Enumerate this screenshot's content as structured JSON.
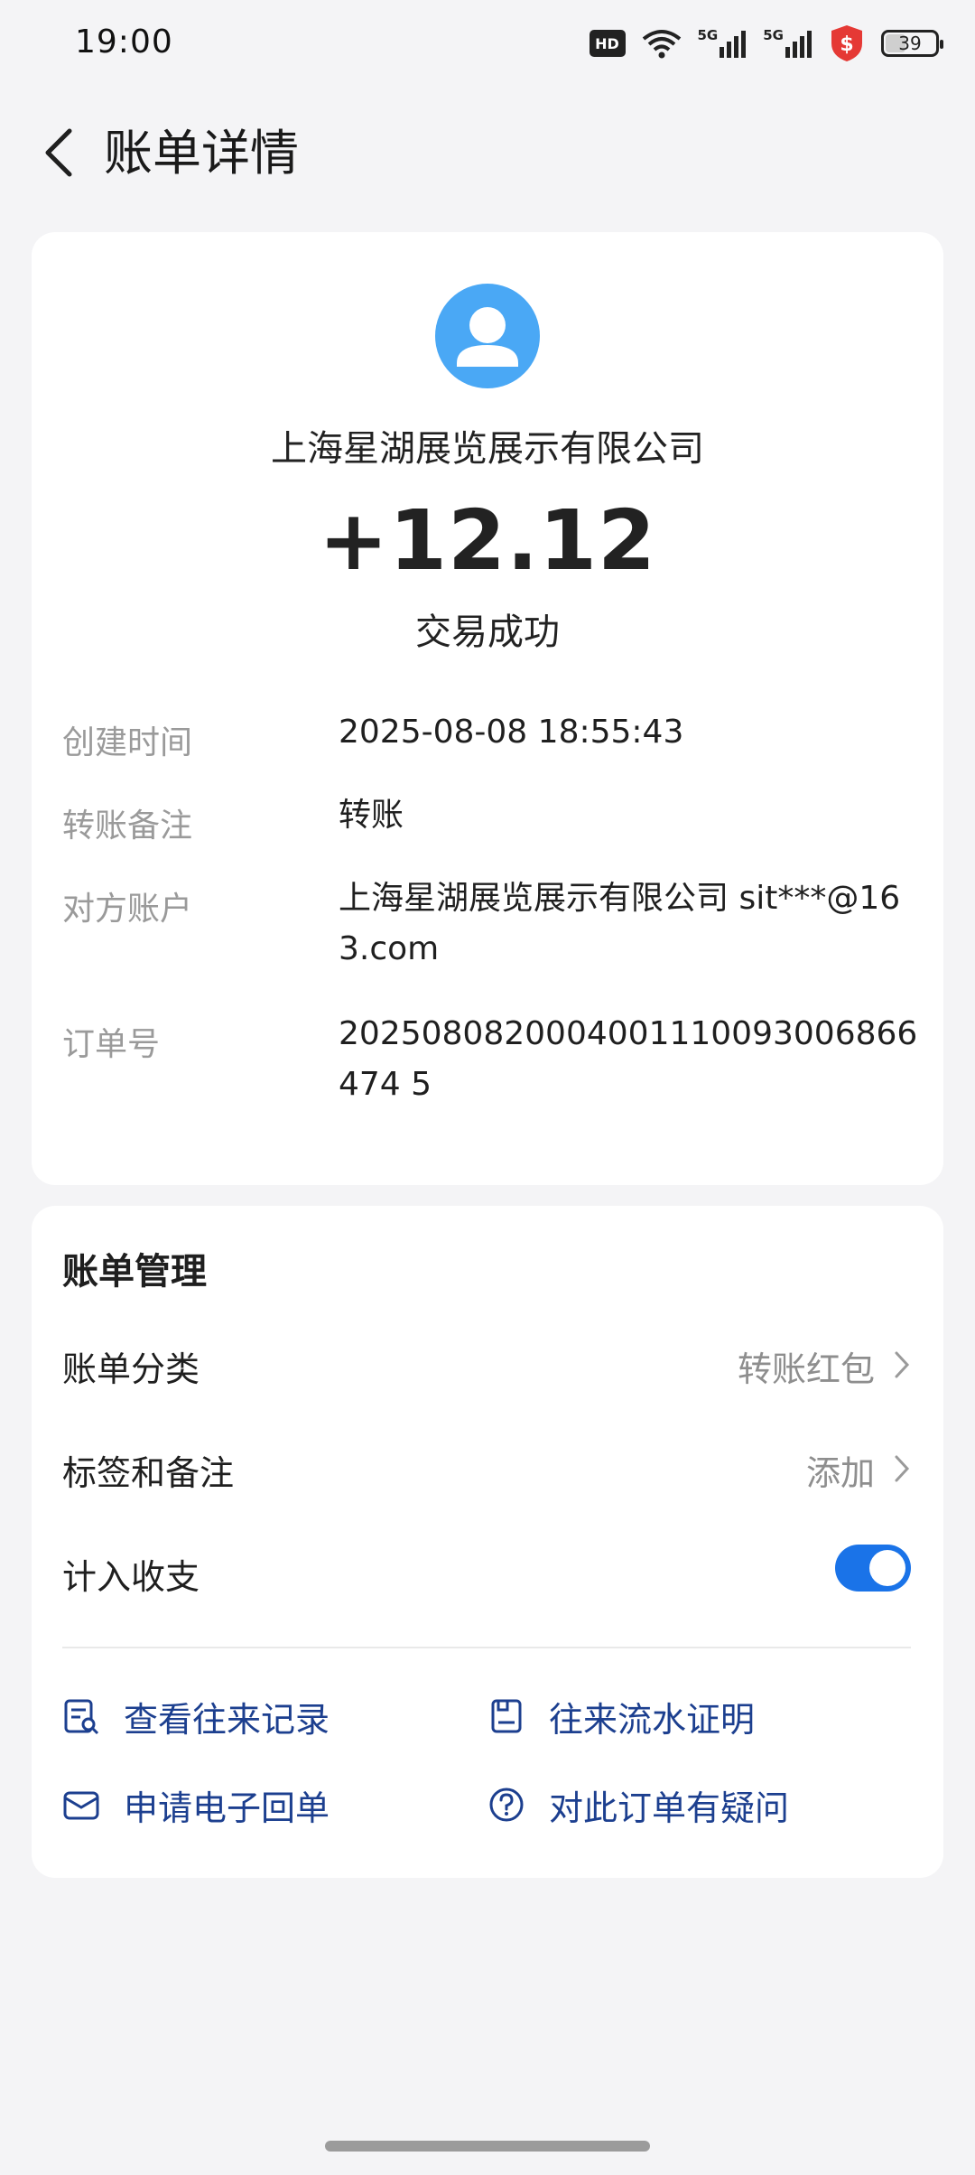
{
  "status_bar": {
    "time": "19:00",
    "hd_label": "HD",
    "signal_1_label": "5G",
    "signal_2_label": "5G",
    "battery_text": "39",
    "battery_level": 0.39,
    "icons": [
      "hd-icon",
      "wifi-icon",
      "signal-icon",
      "signal-icon",
      "security-shield-icon",
      "battery-icon"
    ]
  },
  "header": {
    "title": "账单详情"
  },
  "transaction": {
    "merchant": "上海星湖展览展示有限公司",
    "amount": "+12.12",
    "status": "交易成功"
  },
  "details": [
    {
      "label": "创建时间",
      "value": "2025-08-08 18:55:43"
    },
    {
      "label": "转账备注",
      "value": "转账"
    },
    {
      "label": "对方账户",
      "value": "上海星湖展览展示有限公司 sit***@163.com"
    },
    {
      "label": "订单号",
      "value": "2025080820004001110093006866474 5"
    }
  ],
  "management": {
    "title": "账单管理",
    "category_label": "账单分类",
    "category_value": "转账红包",
    "tags_label": "标签和备注",
    "tags_value": "添加",
    "include_label": "计入收支",
    "include_enabled": true
  },
  "actions": {
    "view_records": "查看往来记录",
    "statement_proof": "往来流水证明",
    "e_receipt": "申请电子回单",
    "question": "对此订单有疑问"
  },
  "colors": {
    "accent": "#1a73e8",
    "link": "#1c3f8f",
    "avatar": "#4aa8f5",
    "shield": "#e53935"
  }
}
